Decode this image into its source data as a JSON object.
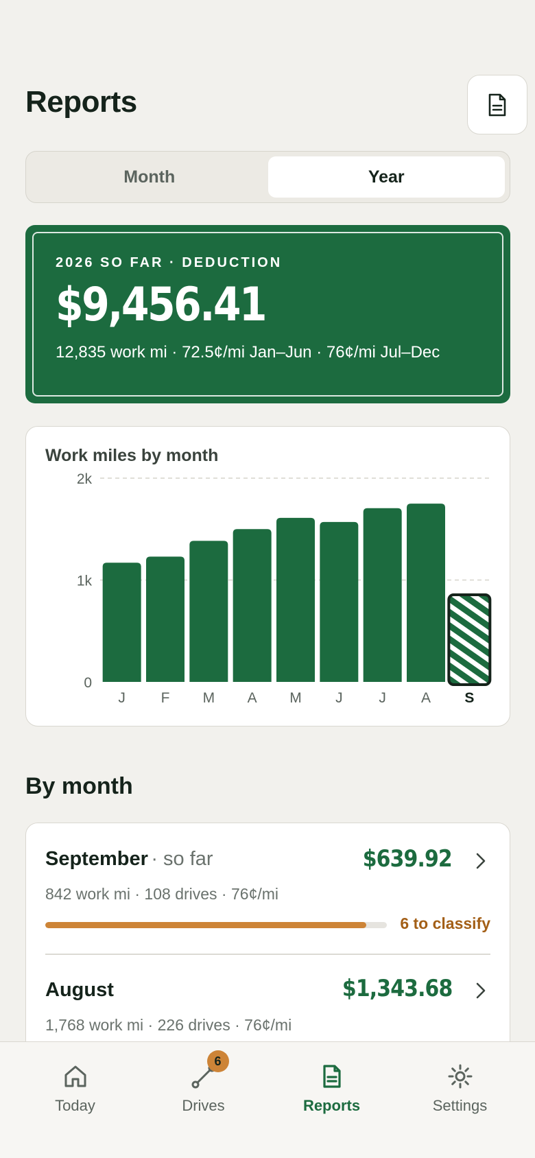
{
  "header": {
    "title": "Reports"
  },
  "period_toggle": {
    "month_label": "Month",
    "year_label": "Year",
    "selected": "Year"
  },
  "summary": {
    "eyebrow": "2026 SO FAR · DEDUCTION",
    "amount": "$9,456.41",
    "subtitle": "12,835 work mi · 72.5¢/mi Jan–Jun · 76¢/mi Jul–Dec"
  },
  "chart_data": {
    "type": "bar",
    "title": "Work miles by month",
    "categories": [
      "J",
      "F",
      "M",
      "A",
      "M",
      "J",
      "J",
      "A",
      "S"
    ],
    "values": [
      1170,
      1230,
      1385,
      1500,
      1610,
      1570,
      1705,
      1750,
      842
    ],
    "current_index": 8,
    "ylim": [
      0,
      2000
    ],
    "yticks": [
      0,
      1000,
      2000
    ],
    "ytick_labels": [
      "0",
      "1k",
      "2k"
    ],
    "grid": true,
    "bar_color": "#1c6b3f"
  },
  "by_month": {
    "title": "By month",
    "items": [
      {
        "name": "September",
        "suffix": "· so far",
        "amount": "$639.92",
        "meta": "842 work mi · 108 drives · 76¢/mi",
        "classified_fraction": 0.94,
        "classify_label": "6 to classify"
      },
      {
        "name": "August",
        "suffix": "",
        "amount": "$1,343.68",
        "meta": "1,768 work mi · 226 drives · 76¢/mi"
      }
    ]
  },
  "tabbar": {
    "items": [
      {
        "label": "Today",
        "icon": "home-icon"
      },
      {
        "label": "Drives",
        "icon": "route-icon",
        "badge": "6"
      },
      {
        "label": "Reports",
        "icon": "document-icon",
        "active": true
      },
      {
        "label": "Settings",
        "icon": "gear-icon"
      }
    ]
  },
  "colors": {
    "accent": "#1c6b3f",
    "warning": "#cd8437",
    "background": "#f2f1ed"
  }
}
